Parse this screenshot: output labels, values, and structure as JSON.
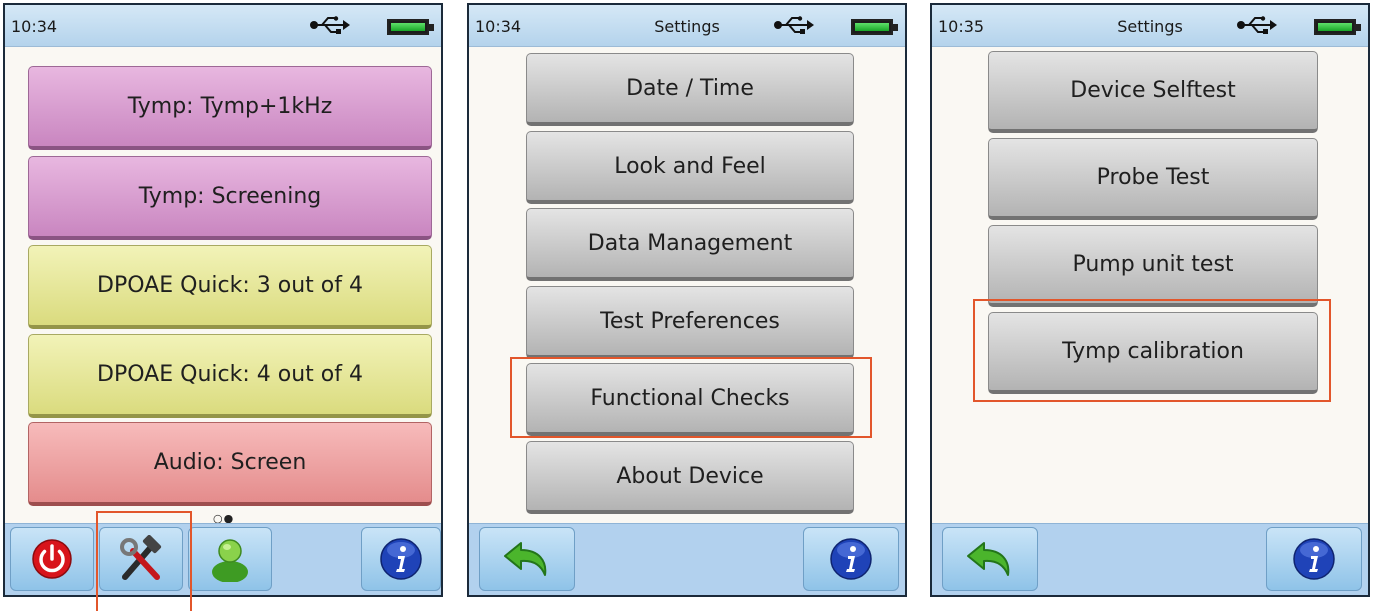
{
  "screens": [
    {
      "status": {
        "time": "10:34",
        "title": ""
      },
      "menu": [
        {
          "label": "Tymp: Tymp+1kHz"
        },
        {
          "label": "Tymp: Screening"
        },
        {
          "label": "DPOAE Quick: 3 out of 4"
        },
        {
          "label": "DPOAE Quick: 4 out of 4"
        },
        {
          "label": "Audio: Screen"
        }
      ],
      "page_indicator": "○●",
      "toolbar": [
        "power-icon",
        "tools-icon",
        "user-icon",
        "info-icon"
      ]
    },
    {
      "status": {
        "time": "10:34",
        "title": "Settings"
      },
      "menu": [
        {
          "label": "Date / Time"
        },
        {
          "label": "Look and Feel"
        },
        {
          "label": "Data Management"
        },
        {
          "label": "Test Preferences"
        },
        {
          "label": "Functional Checks"
        },
        {
          "label": "About Device"
        }
      ],
      "toolbar": [
        "back-arrow-icon",
        "info-icon"
      ]
    },
    {
      "status": {
        "time": "10:35",
        "title": "Settings"
      },
      "menu": [
        {
          "label": "Device Selftest"
        },
        {
          "label": "Probe Test"
        },
        {
          "label": "Pump unit test"
        },
        {
          "label": "Tymp calibration"
        }
      ],
      "toolbar": [
        "back-arrow-icon",
        "info-icon"
      ]
    }
  ],
  "colors": {
    "highlight": "#e2562b",
    "status_bar": "#c4def2",
    "tymp_button": "#d79fcf",
    "dpoae_button": "#e6e79a",
    "audio_button": "#ee9f9f",
    "settings_button": "#c9c9c9"
  }
}
